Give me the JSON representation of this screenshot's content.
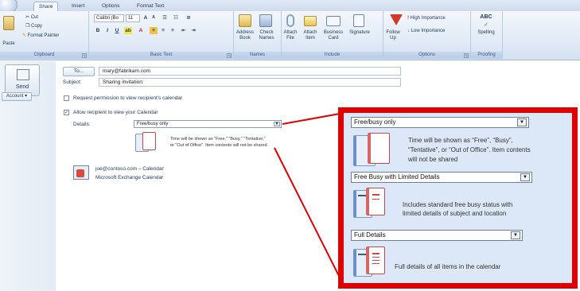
{
  "ribbon": {
    "tabs": [
      "Share",
      "Insert",
      "Options",
      "Format Text"
    ],
    "clipboard": {
      "paste": "Paste",
      "cut": "Cut",
      "copy": "Copy",
      "format_painter": "Format Painter",
      "group": "Clipboard"
    },
    "basic_text": {
      "font": "Calibri (Bo",
      "size": "11",
      "group": "Basic Text"
    },
    "names": {
      "address_book": "Address Book",
      "check_names": "Check Names",
      "group": "Names"
    },
    "include": {
      "attach_file": "Attach File",
      "attach_item": "Attach Item",
      "business_card": "Business Card",
      "signature": "Signature",
      "group": "Include"
    },
    "options": {
      "follow_up": "Follow Up",
      "high_importance": "High Importance",
      "low_importance": "Low Importance",
      "group": "Options"
    },
    "proofing": {
      "spelling": "Spelling",
      "group": "Proofing"
    }
  },
  "left": {
    "send": "Send",
    "account": "Account"
  },
  "form": {
    "to_button": "To...",
    "to_value": "mary@fabrikam.com",
    "subject_label": "Subject:",
    "subject_value": "Sharing invitation:",
    "request_label": "Request permission to view recipient's calendar",
    "request_checked": false,
    "allow_label": "Allow recipient to view your Calendar",
    "allow_checked": true,
    "details_label": "Details:",
    "details_value": "Free/busy only",
    "details_desc_1": "Time will be shown as \"Free,\" \"Busy,\" \"Tentative,\"",
    "details_desc_2": "or \"Out of Office\".  Item contents will not be shared.",
    "calendar_owner": "joe@contoso.com – Calendar",
    "calendar_source": "Microsoft Exchange Calendar"
  },
  "callout": {
    "options": [
      {
        "label": "Free/busy only",
        "desc_lines": [
          "Time will be shown as “Free”, “Busy”,",
          "“Tentative”, or “Out of Office”.  Item contents",
          "will not be shared"
        ]
      },
      {
        "label": "Free Busy with Limited Details",
        "desc_lines": [
          "Includes standard free busy status with",
          "limited details of subject and location"
        ]
      },
      {
        "label": "Full Details",
        "desc_lines": [
          "Full details of all items in the calendar"
        ]
      }
    ]
  },
  "colors": {
    "callout_border": "#e00000",
    "callout_bg": "#dce8f7",
    "ribbon_bg": "#e2ebf6"
  }
}
